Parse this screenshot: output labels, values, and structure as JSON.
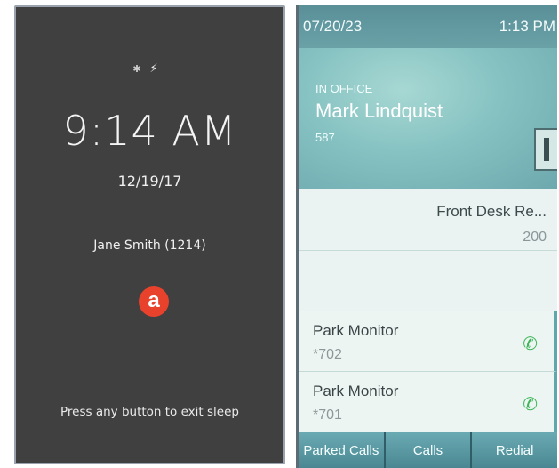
{
  "sleep_screen": {
    "icons": [
      "bluetooth-icon",
      "charging-icon"
    ],
    "time": "9:14 AM",
    "date": "12/19/17",
    "user": "Jane Smith (1214)",
    "logo_letter": "a",
    "hint": "Press any button to exit sleep",
    "colors": {
      "background": "#404040",
      "logo": "#e8412c"
    }
  },
  "desk_phone": {
    "status_bar": {
      "date": "07/20/23",
      "time": "1:13 PM"
    },
    "header": {
      "status": "IN OFFICE",
      "name": "Mark Lindquist",
      "extension": "587"
    },
    "lines": [
      {
        "name": "Front Desk Re...",
        "number": "200"
      }
    ],
    "park_monitors": [
      {
        "label": "Park Monitor",
        "ext": "*702"
      },
      {
        "label": "Park Monitor",
        "ext": "*701"
      }
    ],
    "softkeys": [
      "Parked Calls",
      "Calls",
      "Redial"
    ],
    "colors": {
      "accent": "#5a8f98",
      "call_icon": "#3fb55a"
    }
  }
}
